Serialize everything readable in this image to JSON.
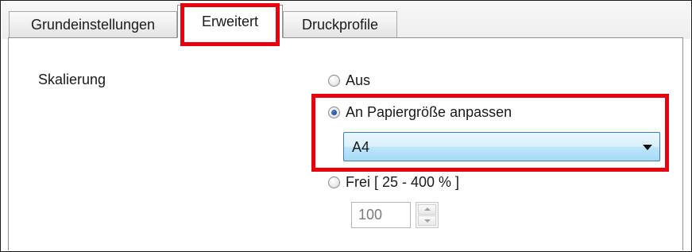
{
  "tabs": [
    {
      "label": "Grundeinstellungen",
      "active": false
    },
    {
      "label": "Erweitert",
      "active": true
    },
    {
      "label": "Druckprofile",
      "active": false
    }
  ],
  "scaling": {
    "label": "Skalierung",
    "options": [
      {
        "label": "Aus",
        "selected": false
      },
      {
        "label": "An Papiergröße anpassen",
        "selected": true
      },
      {
        "label": "Frei [ 25 - 400 % ]",
        "selected": false
      }
    ],
    "paper_size": {
      "value": "A4"
    },
    "free_percent": {
      "value": "100"
    }
  },
  "colors": {
    "highlight": "#e8000e",
    "combo_border": "#3c7fb1",
    "radio_dot": "#123d84"
  }
}
